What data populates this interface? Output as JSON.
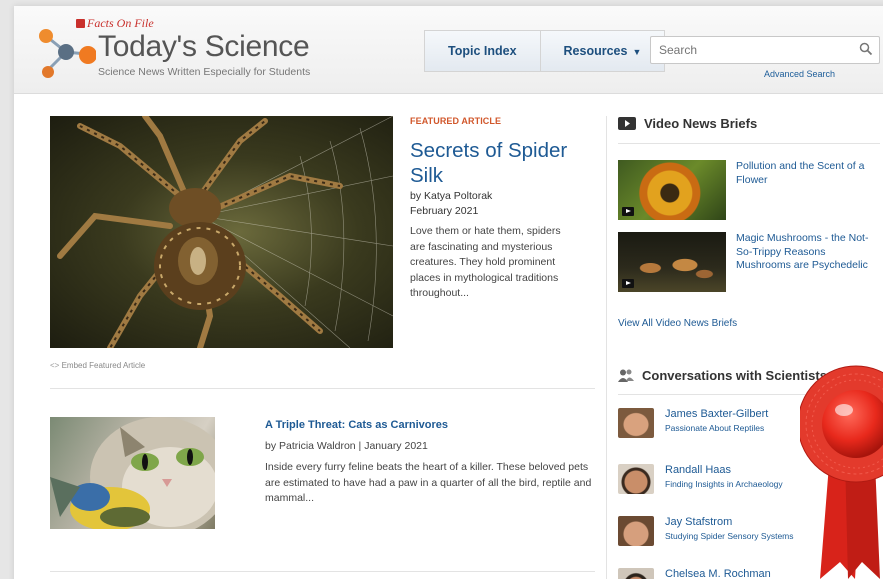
{
  "header": {
    "publisher": "Facts On File",
    "brand": "Today's Science",
    "tagline": "Science News Written Especially for Students",
    "nav": [
      {
        "label": "Topic Index"
      },
      {
        "label": "Resources",
        "caret": "▼"
      }
    ],
    "search": {
      "placeholder": "Search",
      "advanced_label": "Advanced Search"
    }
  },
  "featured": {
    "eyebrow": "FEATURED ARTICLE",
    "title": "Secrets of Spider Silk",
    "author": "by Katya Poltorak",
    "date": "February 2021",
    "excerpt": "Love them or hate them, spiders are fascinating and mysterious creatures. They hold prominent places in mythological traditions throughout...",
    "embed_label": "Embed Featured Article"
  },
  "article2": {
    "title": "A Triple Threat: Cats as Carnivores",
    "byline": "by Patricia Waldron | January 2021",
    "excerpt": "Inside every furry feline beats the heart of a killer. These beloved pets are estimated to have had a paw in a quarter of all the bird, reptile and mammal..."
  },
  "sidebar": {
    "video_heading": "Video News Briefs",
    "videos": [
      {
        "title": "Pollution and the Scent of a Flower"
      },
      {
        "title": "Magic Mushrooms - the Not-So-Trippy Reasons Mushrooms are Psychedelic"
      }
    ],
    "view_all": "View All Video News Briefs",
    "conversations_heading": "Conversations with Scientists",
    "scientists": [
      {
        "name": "James Baxter-Gilbert",
        "subtitle": "Passionate About Reptiles"
      },
      {
        "name": "Randall Haas",
        "subtitle": "Finding Insights in Archaeology"
      },
      {
        "name": "Jay Stafstrom",
        "subtitle": "Studying Spider Sensory Systems"
      },
      {
        "name": "Chelsea M. Rochman",
        "subtitle": ""
      }
    ]
  },
  "colors": {
    "link_blue": "#1e5a94",
    "eyebrow_orange": "#d1572b",
    "rosette_red": "#e8291c"
  }
}
